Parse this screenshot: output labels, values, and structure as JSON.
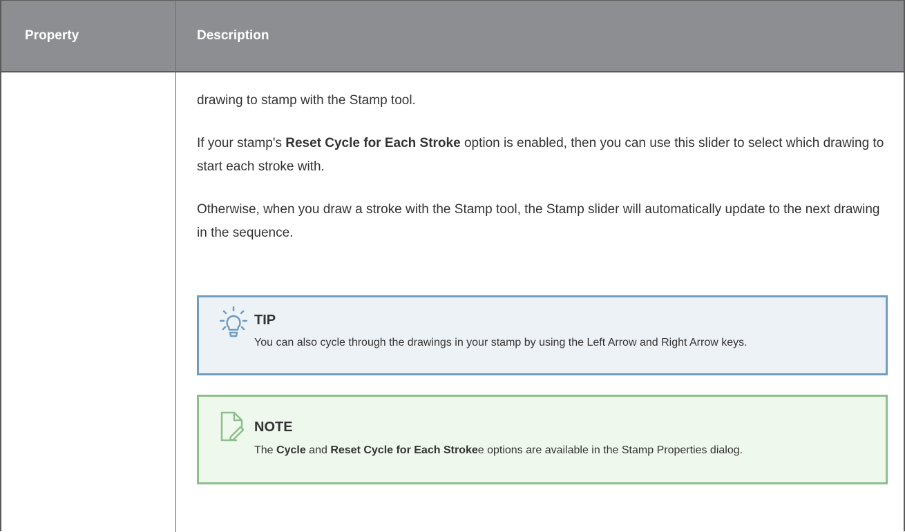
{
  "table": {
    "headers": [
      "Property",
      "Description"
    ]
  },
  "description": {
    "para1": "drawing to stamp with the Stamp tool.",
    "para2": {
      "pre": "If your stamp's ",
      "bold": "Reset Cycle for Each Stroke",
      "post": " option is enabled, then you can use this slider to select which drawing to start each stroke with."
    },
    "para3": "Otherwise, when you draw a stroke with the Stamp tool, the Stamp slider will automatically update to the next drawing in the sequence."
  },
  "tip": {
    "icon": "lightbulb-icon",
    "title": "TIP",
    "body": "You can also cycle through the drawings in your stamp by using the Left Arrow and Right Arrow keys.",
    "color": "#6f9cbf"
  },
  "note": {
    "icon": "note-pencil-icon",
    "title": "NOTE",
    "body_pre": "The ",
    "bold1": "Cycle",
    "body_mid": " and ",
    "bold2": "Reset Cycle for Each Stroke",
    "body_post": "e options are available in the Stamp Properties dialog.",
    "color": "#8dbe8b"
  },
  "colors": {
    "header_bg": "#8d8e91",
    "border": "#5a5a5a"
  }
}
